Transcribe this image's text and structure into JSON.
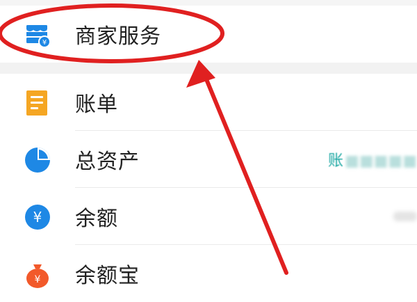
{
  "menu": {
    "merchant_services": "商家服务",
    "bill": "账单",
    "total_assets": "总资产",
    "total_assets_hint": "账",
    "balance": "余额",
    "yuebao": "余额宝"
  },
  "icons": {
    "merchant_services": "store-yuan-icon",
    "bill": "document-list-icon",
    "total_assets": "pie-chart-icon",
    "balance": "yuan-circle-icon",
    "yuebao": "money-bag-icon"
  },
  "colors": {
    "blue": "#1e88e5",
    "orange": "#f5a623",
    "red_orange": "#f2592a",
    "teal": "#1aa7a2",
    "annotation_red": "#e02020"
  }
}
